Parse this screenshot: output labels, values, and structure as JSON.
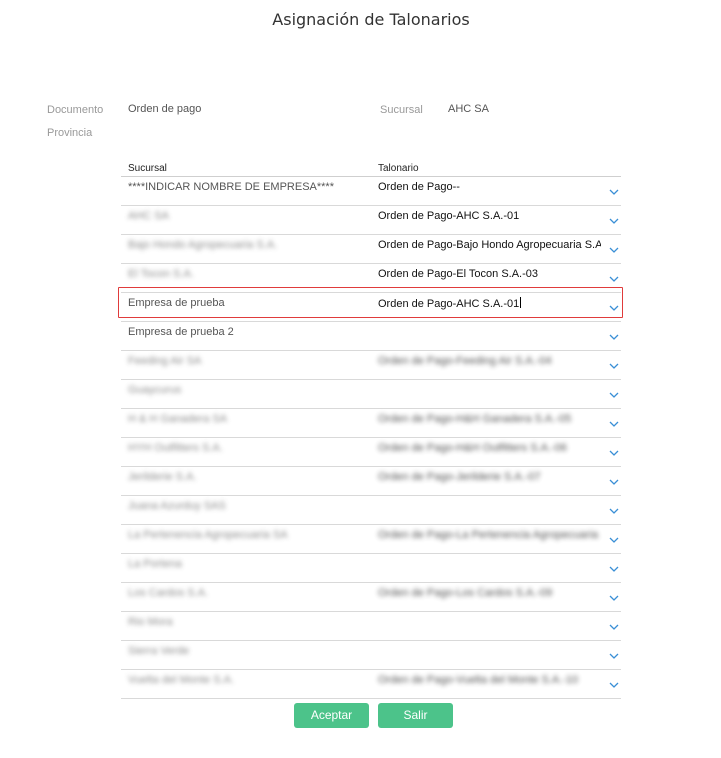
{
  "title": "Asignación de Talonarios",
  "header": {
    "documento_label": "Documento",
    "documento_value": "Orden de pago",
    "sucursal_label": "Sucursal",
    "sucursal_value": "AHC SA",
    "provincia_label": "Provincia"
  },
  "grid": {
    "columns": [
      "Sucursal",
      "Talonario"
    ],
    "rows": [
      {
        "sucursal": "****INDICAR NOMBRE DE EMPRESA****",
        "talonario": "Orden de Pago--",
        "blur_suc": false,
        "blur_tal": false
      },
      {
        "sucursal": "AHC SA",
        "talonario": "Orden de Pago-AHC S.A.-01",
        "blur_suc": true,
        "blur_tal": false
      },
      {
        "sucursal": "Bajo Hondo Agropecuaria S.A.",
        "talonario": "Orden de Pago-Bajo Hondo Agropecuaria S.A.",
        "blur_suc": true,
        "blur_tal": false
      },
      {
        "sucursal": "El Tocon S.A.",
        "talonario": "Orden de Pago-El Tocon S.A.-03",
        "blur_suc": true,
        "blur_tal": false
      },
      {
        "sucursal": "Empresa de prueba",
        "talonario": "Orden de Pago-AHC S.A.-01",
        "blur_suc": false,
        "blur_tal": false,
        "selected": true
      },
      {
        "sucursal": "Empresa de prueba 2",
        "talonario": "",
        "blur_suc": false,
        "blur_tal": false
      },
      {
        "sucursal": "Feeding Air SA",
        "talonario": "Orden de Pago-Feeding Air S.A.-04",
        "blur_suc": true,
        "blur_tal": true
      },
      {
        "sucursal": "Guaycurus",
        "talonario": "",
        "blur_suc": true,
        "blur_tal": false
      },
      {
        "sucursal": "H & H Ganadera SA",
        "talonario": "Orden de Pago-H&H Ganadera S.A.-05",
        "blur_suc": true,
        "blur_tal": true
      },
      {
        "sucursal": "HYH Outfitters S.A.",
        "talonario": "Orden de Pago-H&H Outfitters S.A.-06",
        "blur_suc": true,
        "blur_tal": true
      },
      {
        "sucursal": "Jerilderie S.A.",
        "talonario": "Orden de Pago-Jerilderie S.A.-07",
        "blur_suc": true,
        "blur_tal": true
      },
      {
        "sucursal": "Juana Azurduy SAS",
        "talonario": "",
        "blur_suc": true,
        "blur_tal": false
      },
      {
        "sucursal": "La Pertenencia Agropecuaria SA",
        "talonario": "Orden de Pago-La Pertenencia Agropecuaria SA",
        "blur_suc": true,
        "blur_tal": true
      },
      {
        "sucursal": "La Portena",
        "talonario": "",
        "blur_suc": true,
        "blur_tal": false
      },
      {
        "sucursal": "Los Cardos S.A.",
        "talonario": "Orden de Pago-Los Cardos S.A.-09",
        "blur_suc": true,
        "blur_tal": true
      },
      {
        "sucursal": "Rio Mora",
        "talonario": "",
        "blur_suc": true,
        "blur_tal": false
      },
      {
        "sucursal": "Sierra Verde",
        "talonario": "",
        "blur_suc": true,
        "blur_tal": false
      },
      {
        "sucursal": "Vuelta del Monte S.A.",
        "talonario": "Orden de Pago-Vuelta del Monte S.A.-10",
        "blur_suc": true,
        "blur_tal": true
      }
    ]
  },
  "buttons": {
    "accept_label": "Aceptar",
    "exit_label": "Salir"
  },
  "colors": {
    "accent": "#4cc38a",
    "chevron": "#3a8fd6",
    "selection_border": "#e03b3b"
  }
}
